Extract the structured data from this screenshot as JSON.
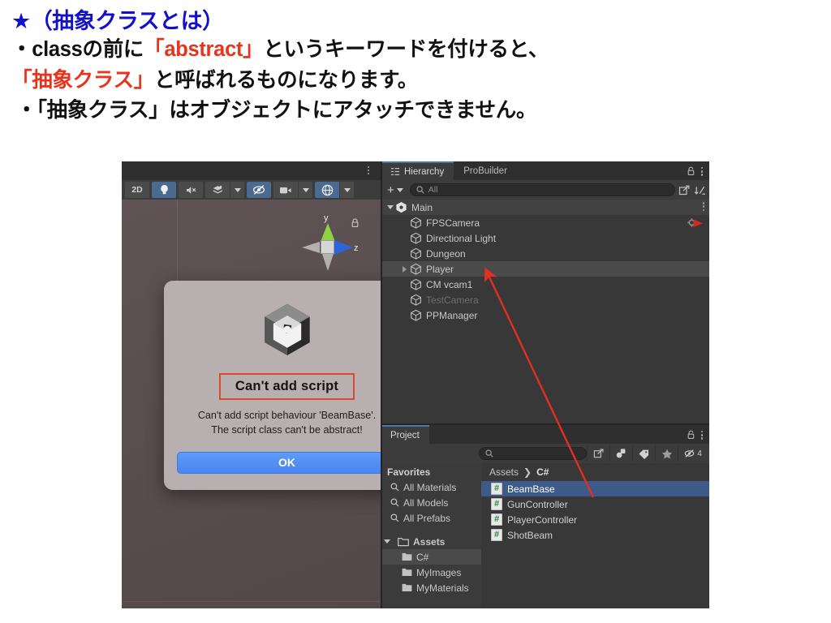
{
  "slide": {
    "heading": "★（抽象クラスとは）",
    "lines": [
      {
        "prefix": "・classの前に",
        "highlight": "「abstract」",
        "suffix": "というキーワードを付けると、"
      },
      {
        "prefix": "",
        "highlight": "「抽象クラス」",
        "suffix": "と呼ばれるものになります。"
      },
      {
        "prefix": "・「抽象クラス」はオブジェクトにアタッチできません。",
        "highlight": "",
        "suffix": ""
      }
    ],
    "accent_blue": "#1111cc",
    "accent_red": "#e8341c"
  },
  "scene_view": {
    "toolbar": {
      "mode_2d": "2D",
      "buttons": [
        {
          "name": "lighting-toggle",
          "active": true
        },
        {
          "name": "audio-toggle",
          "active": false
        },
        {
          "name": "effects-toggle",
          "active": false
        },
        {
          "name": "hidden-objects-toggle",
          "active": true
        },
        {
          "name": "camera-toggle",
          "active": false
        },
        {
          "name": "gizmos-toggle",
          "active": true
        }
      ]
    },
    "gizmo": {
      "y_label": "y",
      "z_label": "z"
    }
  },
  "dialog": {
    "title": "Can't add script",
    "message_line1": "Can't add script behaviour 'BeamBase'.",
    "message_line2": "The script class can't be abstract!",
    "ok_label": "OK",
    "title_border_color": "#d84b2a",
    "ok_color": "#4a84ef"
  },
  "hierarchy": {
    "tabs": [
      {
        "label": "Hierarchy",
        "active": true
      },
      {
        "label": "ProBuilder",
        "active": false
      }
    ],
    "search_placeholder": "All",
    "items": [
      {
        "label": "Main",
        "depth": 0,
        "expanded": true,
        "root": true,
        "dim": false,
        "selected": false
      },
      {
        "label": "FPSCamera",
        "depth": 1,
        "expanded": null,
        "root": false,
        "dim": false,
        "selected": false
      },
      {
        "label": "Directional Light",
        "depth": 1,
        "expanded": null,
        "root": false,
        "dim": false,
        "selected": false
      },
      {
        "label": "Dungeon",
        "depth": 1,
        "expanded": null,
        "root": false,
        "dim": false,
        "selected": false
      },
      {
        "label": "Player",
        "depth": 1,
        "expanded": false,
        "root": false,
        "dim": false,
        "selected": true
      },
      {
        "label": "CM vcam1",
        "depth": 1,
        "expanded": null,
        "root": false,
        "dim": false,
        "selected": false
      },
      {
        "label": "TestCamera",
        "depth": 1,
        "expanded": null,
        "root": false,
        "dim": true,
        "selected": false
      },
      {
        "label": "PPManager",
        "depth": 1,
        "expanded": null,
        "root": false,
        "dim": false,
        "selected": false
      }
    ]
  },
  "project": {
    "tab_label": "Project",
    "search_placeholder": "",
    "hidden_count": "4",
    "favorites_label": "Favorites",
    "favorites": [
      {
        "label": "All Materials"
      },
      {
        "label": "All Models"
      },
      {
        "label": "All Prefabs"
      }
    ],
    "assets_label": "Assets",
    "folders": [
      {
        "label": "C#",
        "selected": true
      },
      {
        "label": "MyImages",
        "selected": false
      },
      {
        "label": "MyMaterials",
        "selected": false
      }
    ],
    "breadcrumb_root": "Assets",
    "breadcrumb_sep": "❯",
    "breadcrumb_current": "C#",
    "assets": [
      {
        "label": "BeamBase",
        "selected": true
      },
      {
        "label": "GunController",
        "selected": false
      },
      {
        "label": "PlayerController",
        "selected": false
      },
      {
        "label": "ShotBeam",
        "selected": false
      }
    ]
  },
  "annotation": {
    "arrow_color": "#e03020",
    "from": "BeamBase asset",
    "to": "Player hierarchy object"
  }
}
